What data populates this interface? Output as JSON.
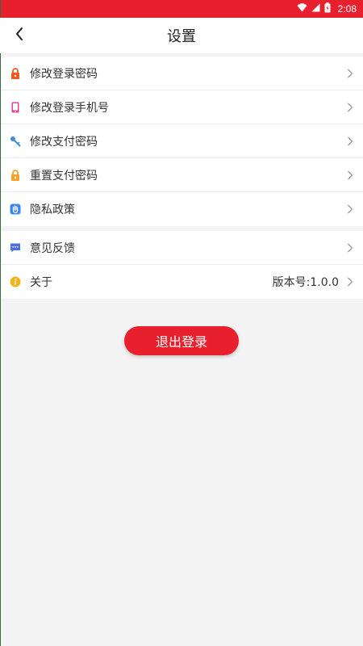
{
  "status_bar": {
    "time": "2:08",
    "color": "#e8202d"
  },
  "header": {
    "title": "设置"
  },
  "settings_group_1": [
    {
      "label": "修改登录密码",
      "icon": "lock-icon",
      "color": "#f0581c"
    },
    {
      "label": "修改登录手机号",
      "icon": "phone-icon",
      "color": "#e83e9c"
    },
    {
      "label": "修改支付密码",
      "icon": "key-icon",
      "color": "#3e8ee0"
    },
    {
      "label": "重置支付密码",
      "icon": "padlock-icon",
      "color": "#f2a22d"
    },
    {
      "label": "隐私政策",
      "icon": "hand-icon",
      "color": "#3e86e8"
    }
  ],
  "settings_group_2": [
    {
      "label": "意见反馈",
      "icon": "chat-icon",
      "color": "#4b6fe3",
      "value": ""
    },
    {
      "label": "关于",
      "icon": "info-icon",
      "color": "#f1b51c",
      "value": "版本号:1.0.0"
    }
  ],
  "logout_button": {
    "label": "退出登录",
    "color": "#e8202d"
  }
}
